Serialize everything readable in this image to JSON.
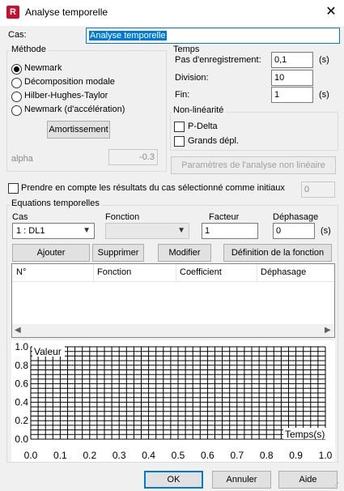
{
  "window": {
    "title": "Analyse temporelle",
    "app_icon_letter": "R"
  },
  "cas": {
    "label": "Cas:",
    "value": "Analyse temporelle"
  },
  "methode": {
    "title": "Méthode",
    "options": [
      "Newmark",
      "Décomposition modale",
      "Hilber-Hughes-Taylor",
      "Newmark (d'accélération)"
    ],
    "selected": 0,
    "amortissement": "Amortissement",
    "alpha_label": "alpha",
    "alpha_value": "-0.3"
  },
  "temps": {
    "title": "Temps",
    "pas_label": "Pas d'enregistrement:",
    "pas_value": "0,1",
    "pas_unit": "(s)",
    "division_label": "Division:",
    "division_value": "10",
    "fin_label": "Fin:",
    "fin_value": "1",
    "fin_unit": "(s)"
  },
  "nonlin": {
    "title": "Non-linéarité",
    "pdelta": "P-Delta",
    "grands": "Grands dépl.",
    "params_button": "Paramètres de l'analyse non linéaire"
  },
  "prendre": {
    "label": "Prendre en compte les résultats du cas sélectionné comme initiaux",
    "value": "0"
  },
  "equations": {
    "title": "Equations temporelles",
    "cas_label": "Cas",
    "cas_value": "1 : DL1",
    "fonction_label": "Fonction",
    "fonction_value": "",
    "facteur_label": "Facteur",
    "facteur_value": "1",
    "dephasage_label": "Déphasage",
    "dephasage_value": "0",
    "dephasage_unit": "(s)",
    "buttons": [
      "Ajouter",
      "Supprimer",
      "Modifier",
      "Définition de la fonction"
    ],
    "columns": [
      "N°",
      "Fonction",
      "Coefficient",
      "Déphasage"
    ]
  },
  "chart_data": {
    "type": "line",
    "series": [],
    "ylabel": "Valeur",
    "xlabel": "Temps(s)",
    "xlim": [
      0.0,
      1.0
    ],
    "ylim": [
      0.0,
      1.0
    ],
    "x_ticks": [
      "0.0",
      "0.1",
      "0.2",
      "0.3",
      "0.4",
      "0.5",
      "0.6",
      "0.7",
      "0.8",
      "0.9",
      "1.0"
    ],
    "y_ticks": [
      "0.0",
      "0.2",
      "0.4",
      "0.6",
      "0.8",
      "1.0"
    ],
    "grid": true
  },
  "footer": {
    "ok": "OK",
    "annuler": "Annuler",
    "aide": "Aide"
  }
}
